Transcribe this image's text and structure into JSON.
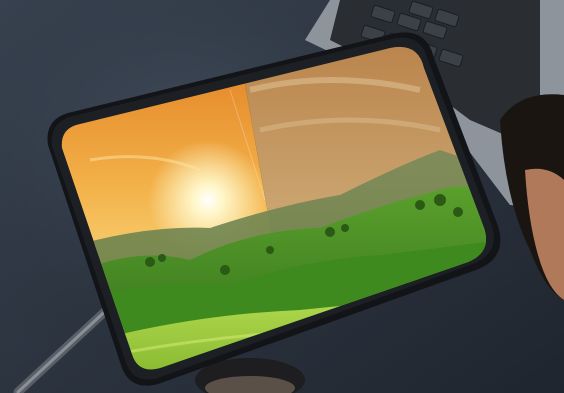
{
  "photo": {
    "subject": "tablet-with-split-landscape-edit",
    "colors": {
      "desk": "#2c3440",
      "tablet_frame": "#121417",
      "sky_warm": "#f0a43a",
      "sky_muted": "#c9a36c",
      "hills_green": "#5aa02c",
      "field_green": "#9bd03a",
      "sun": "#fff6c8"
    },
    "split_fraction": 0.5
  }
}
